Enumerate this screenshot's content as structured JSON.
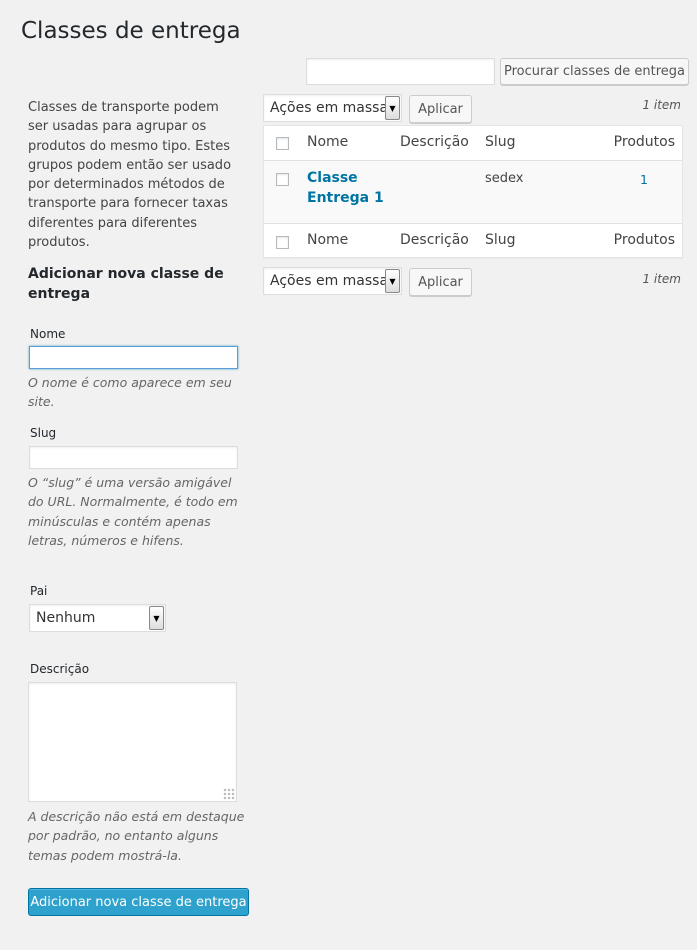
{
  "page": {
    "title": "Classes de entrega",
    "search_button": "Procurar classes de entrega",
    "search_value": ""
  },
  "sidebar": {
    "intro": "Classes de transporte podem ser usadas para agrupar os produtos do mesmo tipo. Estes grupos podem então ser usado por determinados métodos de transporte para fornecer taxas diferentes para diferentes produtos.",
    "add_title": "Adicionar nova classe de entrega",
    "name_label": "Nome",
    "name_hint": "O nome é como aparece em seu site.",
    "slug_label": "Slug",
    "slug_hint": "O “slug” é uma versão amigável do URL. Normalmente, é todo em minúsculas e contém apenas letras, números e hifens.",
    "parent_label": "Pai",
    "parent_selected": "Nenhum",
    "desc_label": "Descrição",
    "desc_hint": "A descrição não está em destaque por padrão, no entanto alguns temas podem mostrá-la.",
    "submit": "Adicionar nova classe de entrega"
  },
  "bulk": {
    "select_label": "Ações em massa",
    "apply": "Aplicar",
    "count": "1 item"
  },
  "table": {
    "columns": {
      "name": "Nome",
      "description": "Descrição",
      "slug": "Slug",
      "products": "Produtos"
    },
    "rows": [
      {
        "name": "Classe Entrega 1",
        "description": "",
        "slug": "sedex",
        "products": "1"
      }
    ]
  },
  "colors": {
    "primary": "#2ea2cc",
    "link": "#0074a2",
    "background": "#f1f1f1"
  }
}
